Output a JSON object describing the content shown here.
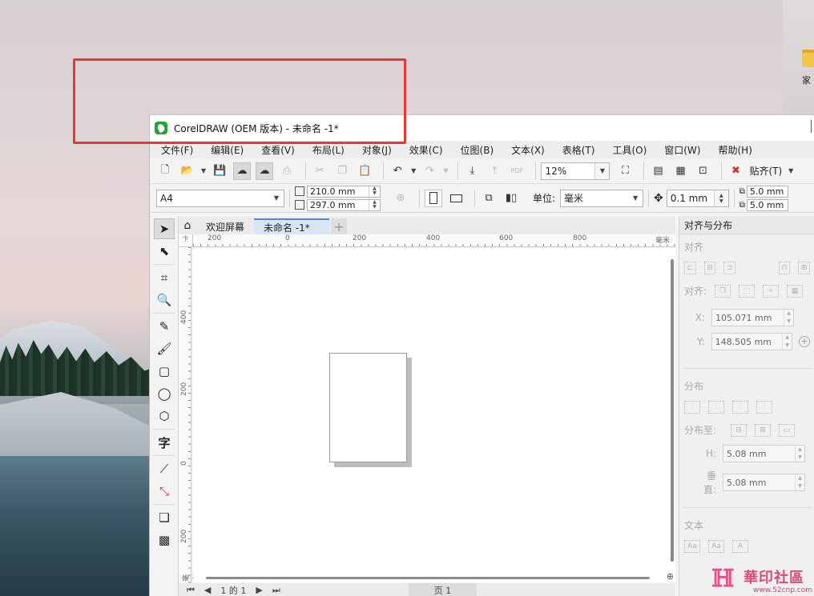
{
  "desktop": {
    "folder_label": "家"
  },
  "window": {
    "title": "CorelDRAW (OEM 版本) - 未命名 -1*"
  },
  "menu": [
    "文件(F)",
    "编辑(E)",
    "查看(V)",
    "布局(L)",
    "对象(J)",
    "效果(C)",
    "位图(B)",
    "文本(X)",
    "表格(T)",
    "工具(O)",
    "窗口(W)",
    "帮助(H)"
  ],
  "toolbar": {
    "zoom_value": "12%",
    "snap_label": "贴齐(T)",
    "pdf_label": "PDF"
  },
  "property_bar": {
    "page_size": "A4",
    "width": "210.0 mm",
    "height": "297.0 mm",
    "unit_label": "单位:",
    "unit_value": "毫米",
    "nudge": "0.1 mm",
    "dup_x": "5.0 mm",
    "dup_y": "5.0 mm"
  },
  "tabs": {
    "welcome": "欢迎屏幕",
    "document": "未命名 -1*",
    "add": "+"
  },
  "rulers": {
    "h_ticks": [
      "200",
      "0",
      "200",
      "400",
      "600",
      "800"
    ],
    "h_unit": "毫米",
    "v_ticks": [
      "400",
      "200",
      "0",
      "200"
    ],
    "v_unit": "毫米",
    "corner": "卞"
  },
  "status": {
    "page_nav": "1 的 1",
    "page_tab": "页 1"
  },
  "docker": {
    "title": "对齐与分布",
    "align_section": "对齐",
    "align_to_label": "对齐:",
    "x_label": "X:",
    "x_value": "105.071 mm",
    "y_label": "Y:",
    "y_value": "148.505 mm",
    "distribute_section": "分布",
    "distribute_to_label": "分布至:",
    "h_label": "H:",
    "h_value": "5.08 mm",
    "v_label": "垂直:",
    "v_value": "5.08 mm",
    "text_section": "文本",
    "text_icon_labels": [
      "Aa",
      "Aa",
      "A"
    ]
  },
  "watermark": {
    "text": "華印社區",
    "url": "www.52cnp.com"
  }
}
